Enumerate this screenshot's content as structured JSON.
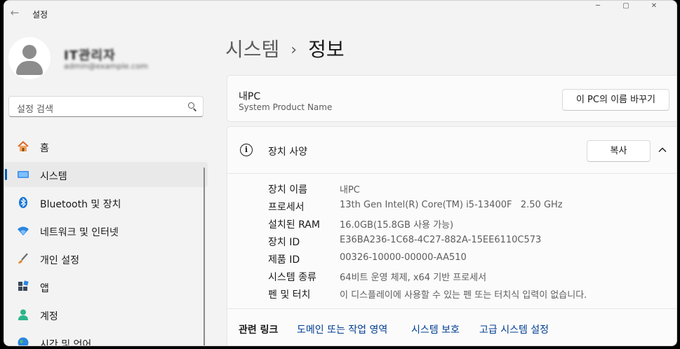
{
  "app": {
    "title": "설정"
  },
  "user": {
    "name": "IT관리자",
    "email": "admin@example.com"
  },
  "search": {
    "placeholder": "설정 검색"
  },
  "nav": [
    {
      "label": "홈",
      "icon": "home-icon"
    },
    {
      "label": "시스템",
      "icon": "system-monitor-icon",
      "active": true
    },
    {
      "label": "Bluetooth 및 장치",
      "icon": "bluetooth-icon"
    },
    {
      "label": "네트워크 및 인터넷",
      "icon": "wifi-icon"
    },
    {
      "label": "개인 설정",
      "icon": "brush-icon"
    },
    {
      "label": "앱",
      "icon": "apps-icon"
    },
    {
      "label": "계정",
      "icon": "account-icon"
    },
    {
      "label": "시간 및 언어",
      "icon": "globe-icon"
    }
  ],
  "breadcrumb": {
    "parent": "시스템",
    "separator": "›",
    "current": "정보"
  },
  "pc_card": {
    "name": "내PC",
    "subtitle": "System Product Name",
    "rename_button": "이 PC의 이름 바꾸기"
  },
  "specs": {
    "title": "장치 사양",
    "copy_button": "복사",
    "rows": [
      {
        "key": "장치 이름",
        "value": "내PC"
      },
      {
        "key": "프로세서",
        "value": "13th Gen Intel(R) Core(TM) i5-13400F   2.50 GHz"
      },
      {
        "key": "설치된 RAM",
        "value": "16.0GB(15.8GB 사용 가능)"
      },
      {
        "key": "장치 ID",
        "value": "E36BA236-1C68-4C27-882A-15EE6110C573"
      },
      {
        "key": "제품 ID",
        "value": "00326-10000-00000-AA510"
      },
      {
        "key": "시스템 종류",
        "value": "64비트 운영 체제, x64 기반 프로세서"
      },
      {
        "key": "펜 및 터치",
        "value": "이 디스플레이에 사용할 수 있는 펜 또는 터치식 입력이 없습니다."
      }
    ]
  },
  "related": {
    "label": "관련 링크",
    "links": [
      "도메인 또는 작업 영역",
      "시스템 보호",
      "고급 시스템 설정"
    ]
  },
  "colors": {
    "accent": "#005fb8",
    "link": "#003e92",
    "background": "#f3f3f3",
    "card": "#fbfbfb"
  }
}
